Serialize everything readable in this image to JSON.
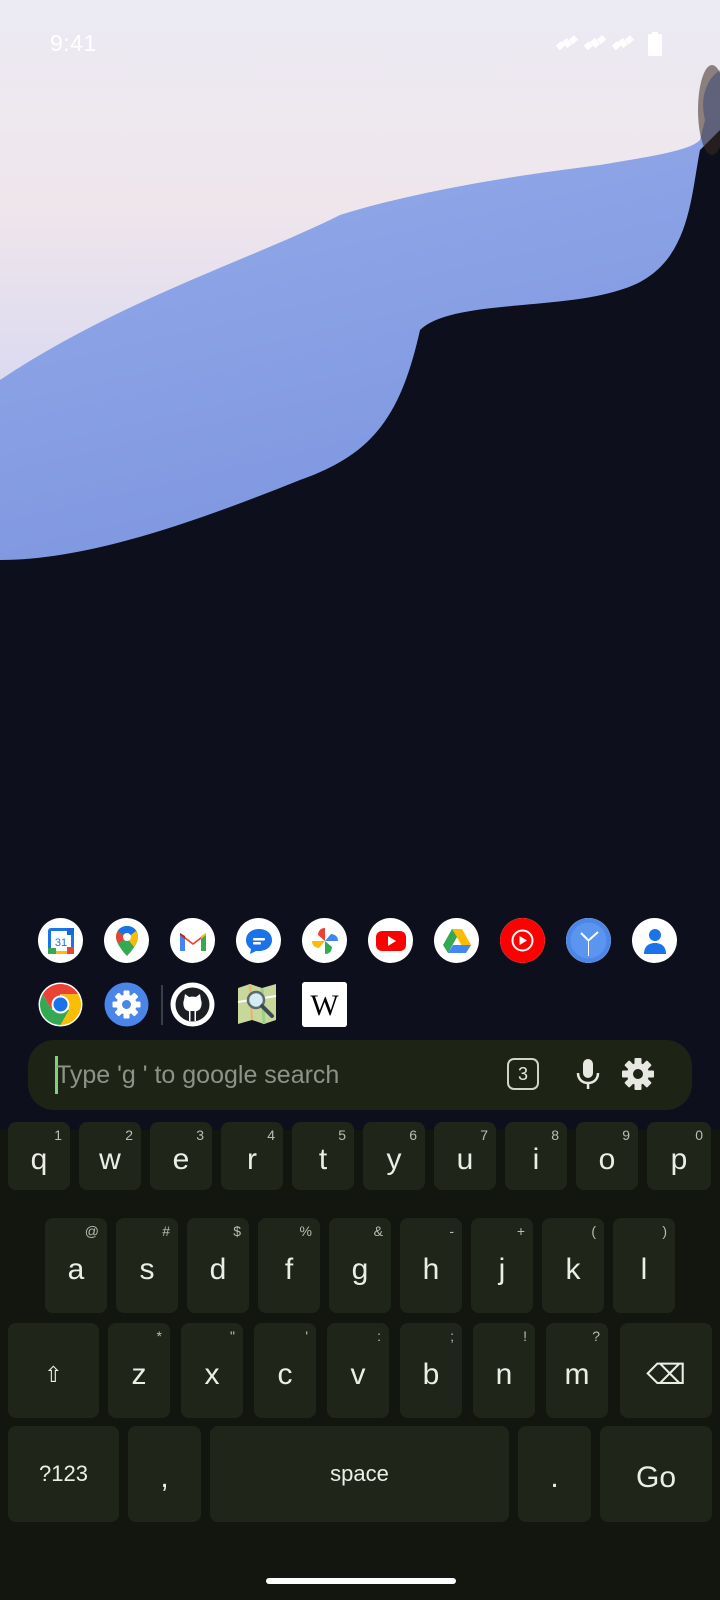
{
  "status": {
    "time": "9:41"
  },
  "apps_row1": [
    {
      "name": "Calendar",
      "icon": "calendar-icon",
      "text": "31"
    },
    {
      "name": "Maps",
      "icon": "maps-icon"
    },
    {
      "name": "Gmail",
      "icon": "gmail-icon"
    },
    {
      "name": "Messages",
      "icon": "messages-icon"
    },
    {
      "name": "Photos",
      "icon": "photos-icon"
    },
    {
      "name": "YouTube",
      "icon": "youtube-icon"
    },
    {
      "name": "Drive",
      "icon": "drive-icon"
    },
    {
      "name": "YouTube Music",
      "icon": "youtube-music-icon"
    },
    {
      "name": "Clock",
      "icon": "clock-icon"
    },
    {
      "name": "Contacts",
      "icon": "contacts-icon"
    }
  ],
  "apps_row2": [
    {
      "name": "Chrome",
      "icon": "chrome-icon"
    },
    {
      "name": "Settings",
      "icon": "settings-icon"
    },
    {
      "name": "GitHub",
      "icon": "github-icon"
    },
    {
      "name": "OsmAnd",
      "icon": "map-search-icon"
    },
    {
      "name": "Wikipedia",
      "icon": "wikipedia-icon",
      "text": "W"
    }
  ],
  "search": {
    "placeholder": "Type 'g ' to google search",
    "badge": "3"
  },
  "keyboard": {
    "row1": [
      {
        "label": "q",
        "hint": "1"
      },
      {
        "label": "w",
        "hint": "2"
      },
      {
        "label": "e",
        "hint": "3"
      },
      {
        "label": "r",
        "hint": "4"
      },
      {
        "label": "t",
        "hint": "5"
      },
      {
        "label": "y",
        "hint": "6"
      },
      {
        "label": "u",
        "hint": "7"
      },
      {
        "label": "i",
        "hint": "8"
      },
      {
        "label": "o",
        "hint": "9"
      },
      {
        "label": "p",
        "hint": "0"
      }
    ],
    "row2": [
      {
        "label": "a",
        "hint": "@"
      },
      {
        "label": "s",
        "hint": "#"
      },
      {
        "label": "d",
        "hint": "$"
      },
      {
        "label": "f",
        "hint": "%"
      },
      {
        "label": "g",
        "hint": "&"
      },
      {
        "label": "h",
        "hint": "-"
      },
      {
        "label": "j",
        "hint": "+"
      },
      {
        "label": "k",
        "hint": "("
      },
      {
        "label": "l",
        "hint": ")"
      }
    ],
    "row3": [
      {
        "label": "z",
        "hint": "*"
      },
      {
        "label": "x",
        "hint": "\""
      },
      {
        "label": "c",
        "hint": "'"
      },
      {
        "label": "v",
        "hint": ":"
      },
      {
        "label": "b",
        "hint": ";"
      },
      {
        "label": "n",
        "hint": "!"
      },
      {
        "label": "m",
        "hint": "?"
      }
    ],
    "shift": "⇧",
    "backspace": "⌫",
    "symbols": "?123",
    "comma": ",",
    "space": "space",
    "period": ".",
    "go": "Go"
  },
  "colors": {
    "accent": "#7fd17a",
    "keyboard_bg": "#12160f",
    "key_bg": "#1f2619",
    "search_bg": "#1d2416"
  }
}
